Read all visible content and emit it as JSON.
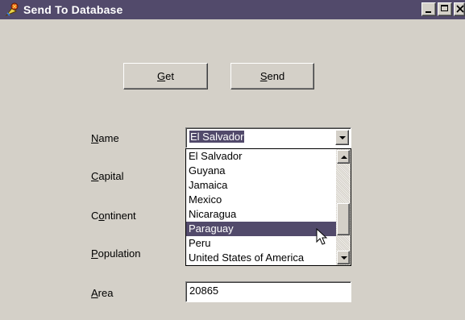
{
  "window": {
    "title": "Send To Database",
    "controls": [
      "minimize",
      "maximize",
      "close"
    ]
  },
  "buttons": {
    "get": {
      "mnemonic": "G",
      "rest": "et"
    },
    "send": {
      "mnemonic": "S",
      "rest": "end"
    }
  },
  "form": {
    "name": {
      "pre": "",
      "mnemonic": "N",
      "rest": "ame"
    },
    "capital": {
      "pre": "",
      "mnemonic": "C",
      "rest": "apital"
    },
    "continent": {
      "pre": "C",
      "mnemonic": "o",
      "rest": "ntinent"
    },
    "population": {
      "pre": "",
      "mnemonic": "P",
      "rest": "opulation"
    },
    "area": {
      "pre": "",
      "mnemonic": "A",
      "rest": "rea"
    }
  },
  "combo": {
    "value": "El Salvador",
    "items": [
      "El Salvador",
      "Guyana",
      "Jamaica",
      "Mexico",
      "Nicaragua",
      "Paraguay",
      "Peru",
      "United States of America"
    ],
    "highlighted": "Paraguay"
  },
  "area_value": "20865",
  "colors": {
    "titlebar": "#524a6b",
    "selection": "#524a6b",
    "face": "#d4d0c8"
  },
  "icons": {
    "app": "app-icon",
    "cursor": "mouse-pointer-icon"
  }
}
